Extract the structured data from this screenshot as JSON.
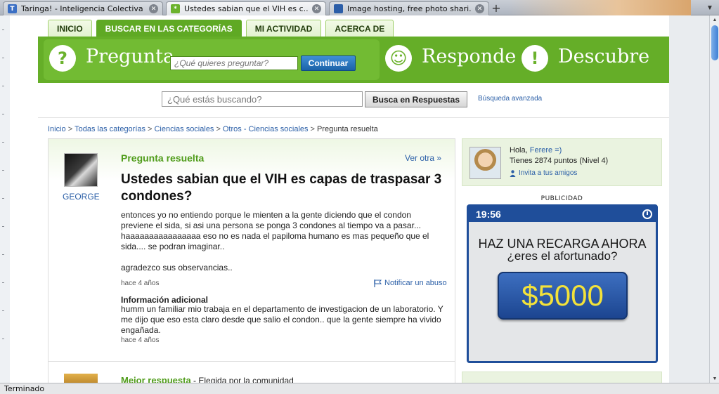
{
  "browser": {
    "tabs": [
      {
        "label": "Taringa! - Inteligencia Colectiva",
        "favicon": "T",
        "favicon_color": "#3b6fc4",
        "active": false
      },
      {
        "label": "Ustedes sabian que el VIH es c...",
        "favicon": "*",
        "favicon_color": "#6bb22c",
        "active": true
      },
      {
        "label": "Image hosting, free photo shari...",
        "favicon": "",
        "favicon_color": "#2c5ea8",
        "active": false
      }
    ],
    "new_tab": "+",
    "status": "Terminado"
  },
  "site": {
    "nav": [
      "INICIO",
      "BUSCAR EN LAS CATEGORÍAS",
      "MI ACTIVIDAD",
      "ACERCA DE"
    ],
    "nav_active_index": 1,
    "ask": {
      "title": "Pregunta",
      "placeholder": "¿Qué quieres preguntar?",
      "button": "Continuar"
    },
    "answer_title": "Responde",
    "discover_title": "Descubre",
    "search": {
      "placeholder": "¿Qué estás buscando?",
      "button": "Busca en Respuestas",
      "advanced": "Búsqueda avanzada"
    },
    "breadcrumb": [
      "Inicio",
      "Todas las categorías",
      "Ciencias sociales",
      "Otros - Ciencias sociales",
      "Pregunta resuelta"
    ],
    "accent_green": "#65ae28",
    "link_color": "#2b5fa7"
  },
  "question": {
    "status": "Pregunta resuelta",
    "see_other": "Ver otra »",
    "asker": "GEORGE",
    "title": "Ustedes sabian que el VIH es capas de traspasar 3 condones?",
    "body1": "entonces yo no entiendo porque le mienten a la gente diciendo que el condon previene el sida, si asi una persona se ponga 3 condones al tiempo va a pasar... haaaaaaaaaaaaaaaa eso no es nada el papiloma humano es mas pequeño que el sida.... se podran imaginar..",
    "body2": "agradezco sus observancias..",
    "time": "hace 4 años",
    "report": "Notificar un abuso",
    "additional_title": "Información adicional",
    "additional_body": "humm un familiar mio trabaja en el departamento de investigacion de un laboratorio. Y me dijo que eso esta claro desde que salio el condon.. que la gente siempre ha vivido engañada.",
    "additional_time": "hace 4 años",
    "best_answer": "Mejor respuesta",
    "best_answer_detail": " - Elegida por la comunidad"
  },
  "user": {
    "greeting": "Hola, ",
    "name": "Ferere =)",
    "points": "Tienes 2874 puntos (Nivel 4)",
    "invite": "Invita a tus amigos"
  },
  "ad": {
    "label": "PUBLICIDAD",
    "clock": "19:56",
    "line1": "HAZ UNA RECARGA AHORA",
    "line2": "¿eres el afortunado?",
    "prize": "$5000"
  }
}
